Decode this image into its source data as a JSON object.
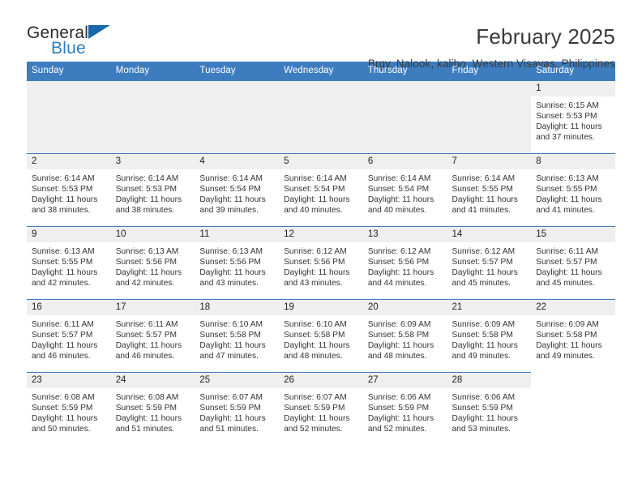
{
  "brand": {
    "word_one": "General",
    "word_two": "Blue",
    "triangle_icon": "triangle-icon",
    "accent": "#2f7fc1"
  },
  "header": {
    "title": "February 2025",
    "subtitle": "Brgy. Nalook, kalibo, Western Visayas, Philippines"
  },
  "colors": {
    "header_blue": "#3d7dbf",
    "daynum_gray": "#efefef",
    "text": "#222222"
  },
  "calendar": {
    "weekdays": [
      "Sunday",
      "Monday",
      "Tuesday",
      "Wednesday",
      "Thursday",
      "Friday",
      "Saturday"
    ],
    "labels": {
      "sunrise": "Sunrise:",
      "sunset": "Sunset:",
      "daylight": "Daylight:"
    },
    "weeks": [
      [
        {
          "day": ""
        },
        {
          "day": ""
        },
        {
          "day": ""
        },
        {
          "day": ""
        },
        {
          "day": ""
        },
        {
          "day": ""
        },
        {
          "day": "1",
          "sunrise": "Sunrise: 6:15 AM",
          "sunset": "Sunset: 5:53 PM",
          "daylight": "Daylight: 11 hours and 37 minutes."
        }
      ],
      [
        {
          "day": "2",
          "sunrise": "Sunrise: 6:14 AM",
          "sunset": "Sunset: 5:53 PM",
          "daylight": "Daylight: 11 hours and 38 minutes."
        },
        {
          "day": "3",
          "sunrise": "Sunrise: 6:14 AM",
          "sunset": "Sunset: 5:53 PM",
          "daylight": "Daylight: 11 hours and 38 minutes."
        },
        {
          "day": "4",
          "sunrise": "Sunrise: 6:14 AM",
          "sunset": "Sunset: 5:54 PM",
          "daylight": "Daylight: 11 hours and 39 minutes."
        },
        {
          "day": "5",
          "sunrise": "Sunrise: 6:14 AM",
          "sunset": "Sunset: 5:54 PM",
          "daylight": "Daylight: 11 hours and 40 minutes."
        },
        {
          "day": "6",
          "sunrise": "Sunrise: 6:14 AM",
          "sunset": "Sunset: 5:54 PM",
          "daylight": "Daylight: 11 hours and 40 minutes."
        },
        {
          "day": "7",
          "sunrise": "Sunrise: 6:14 AM",
          "sunset": "Sunset: 5:55 PM",
          "daylight": "Daylight: 11 hours and 41 minutes."
        },
        {
          "day": "8",
          "sunrise": "Sunrise: 6:13 AM",
          "sunset": "Sunset: 5:55 PM",
          "daylight": "Daylight: 11 hours and 41 minutes."
        }
      ],
      [
        {
          "day": "9",
          "sunrise": "Sunrise: 6:13 AM",
          "sunset": "Sunset: 5:55 PM",
          "daylight": "Daylight: 11 hours and 42 minutes."
        },
        {
          "day": "10",
          "sunrise": "Sunrise: 6:13 AM",
          "sunset": "Sunset: 5:56 PM",
          "daylight": "Daylight: 11 hours and 42 minutes."
        },
        {
          "day": "11",
          "sunrise": "Sunrise: 6:13 AM",
          "sunset": "Sunset: 5:56 PM",
          "daylight": "Daylight: 11 hours and 43 minutes."
        },
        {
          "day": "12",
          "sunrise": "Sunrise: 6:12 AM",
          "sunset": "Sunset: 5:56 PM",
          "daylight": "Daylight: 11 hours and 43 minutes."
        },
        {
          "day": "13",
          "sunrise": "Sunrise: 6:12 AM",
          "sunset": "Sunset: 5:56 PM",
          "daylight": "Daylight: 11 hours and 44 minutes."
        },
        {
          "day": "14",
          "sunrise": "Sunrise: 6:12 AM",
          "sunset": "Sunset: 5:57 PM",
          "daylight": "Daylight: 11 hours and 45 minutes."
        },
        {
          "day": "15",
          "sunrise": "Sunrise: 6:11 AM",
          "sunset": "Sunset: 5:57 PM",
          "daylight": "Daylight: 11 hours and 45 minutes."
        }
      ],
      [
        {
          "day": "16",
          "sunrise": "Sunrise: 6:11 AM",
          "sunset": "Sunset: 5:57 PM",
          "daylight": "Daylight: 11 hours and 46 minutes."
        },
        {
          "day": "17",
          "sunrise": "Sunrise: 6:11 AM",
          "sunset": "Sunset: 5:57 PM",
          "daylight": "Daylight: 11 hours and 46 minutes."
        },
        {
          "day": "18",
          "sunrise": "Sunrise: 6:10 AM",
          "sunset": "Sunset: 5:58 PM",
          "daylight": "Daylight: 11 hours and 47 minutes."
        },
        {
          "day": "19",
          "sunrise": "Sunrise: 6:10 AM",
          "sunset": "Sunset: 5:58 PM",
          "daylight": "Daylight: 11 hours and 48 minutes."
        },
        {
          "day": "20",
          "sunrise": "Sunrise: 6:09 AM",
          "sunset": "Sunset: 5:58 PM",
          "daylight": "Daylight: 11 hours and 48 minutes."
        },
        {
          "day": "21",
          "sunrise": "Sunrise: 6:09 AM",
          "sunset": "Sunset: 5:58 PM",
          "daylight": "Daylight: 11 hours and 49 minutes."
        },
        {
          "day": "22",
          "sunrise": "Sunrise: 6:09 AM",
          "sunset": "Sunset: 5:58 PM",
          "daylight": "Daylight: 11 hours and 49 minutes."
        }
      ],
      [
        {
          "day": "23",
          "sunrise": "Sunrise: 6:08 AM",
          "sunset": "Sunset: 5:59 PM",
          "daylight": "Daylight: 11 hours and 50 minutes."
        },
        {
          "day": "24",
          "sunrise": "Sunrise: 6:08 AM",
          "sunset": "Sunset: 5:59 PM",
          "daylight": "Daylight: 11 hours and 51 minutes."
        },
        {
          "day": "25",
          "sunrise": "Sunrise: 6:07 AM",
          "sunset": "Sunset: 5:59 PM",
          "daylight": "Daylight: 11 hours and 51 minutes."
        },
        {
          "day": "26",
          "sunrise": "Sunrise: 6:07 AM",
          "sunset": "Sunset: 5:59 PM",
          "daylight": "Daylight: 11 hours and 52 minutes."
        },
        {
          "day": "27",
          "sunrise": "Sunrise: 6:06 AM",
          "sunset": "Sunset: 5:59 PM",
          "daylight": "Daylight: 11 hours and 52 minutes."
        },
        {
          "day": "28",
          "sunrise": "Sunrise: 6:06 AM",
          "sunset": "Sunset: 5:59 PM",
          "daylight": "Daylight: 11 hours and 53 minutes."
        },
        {
          "day": ""
        }
      ]
    ]
  }
}
